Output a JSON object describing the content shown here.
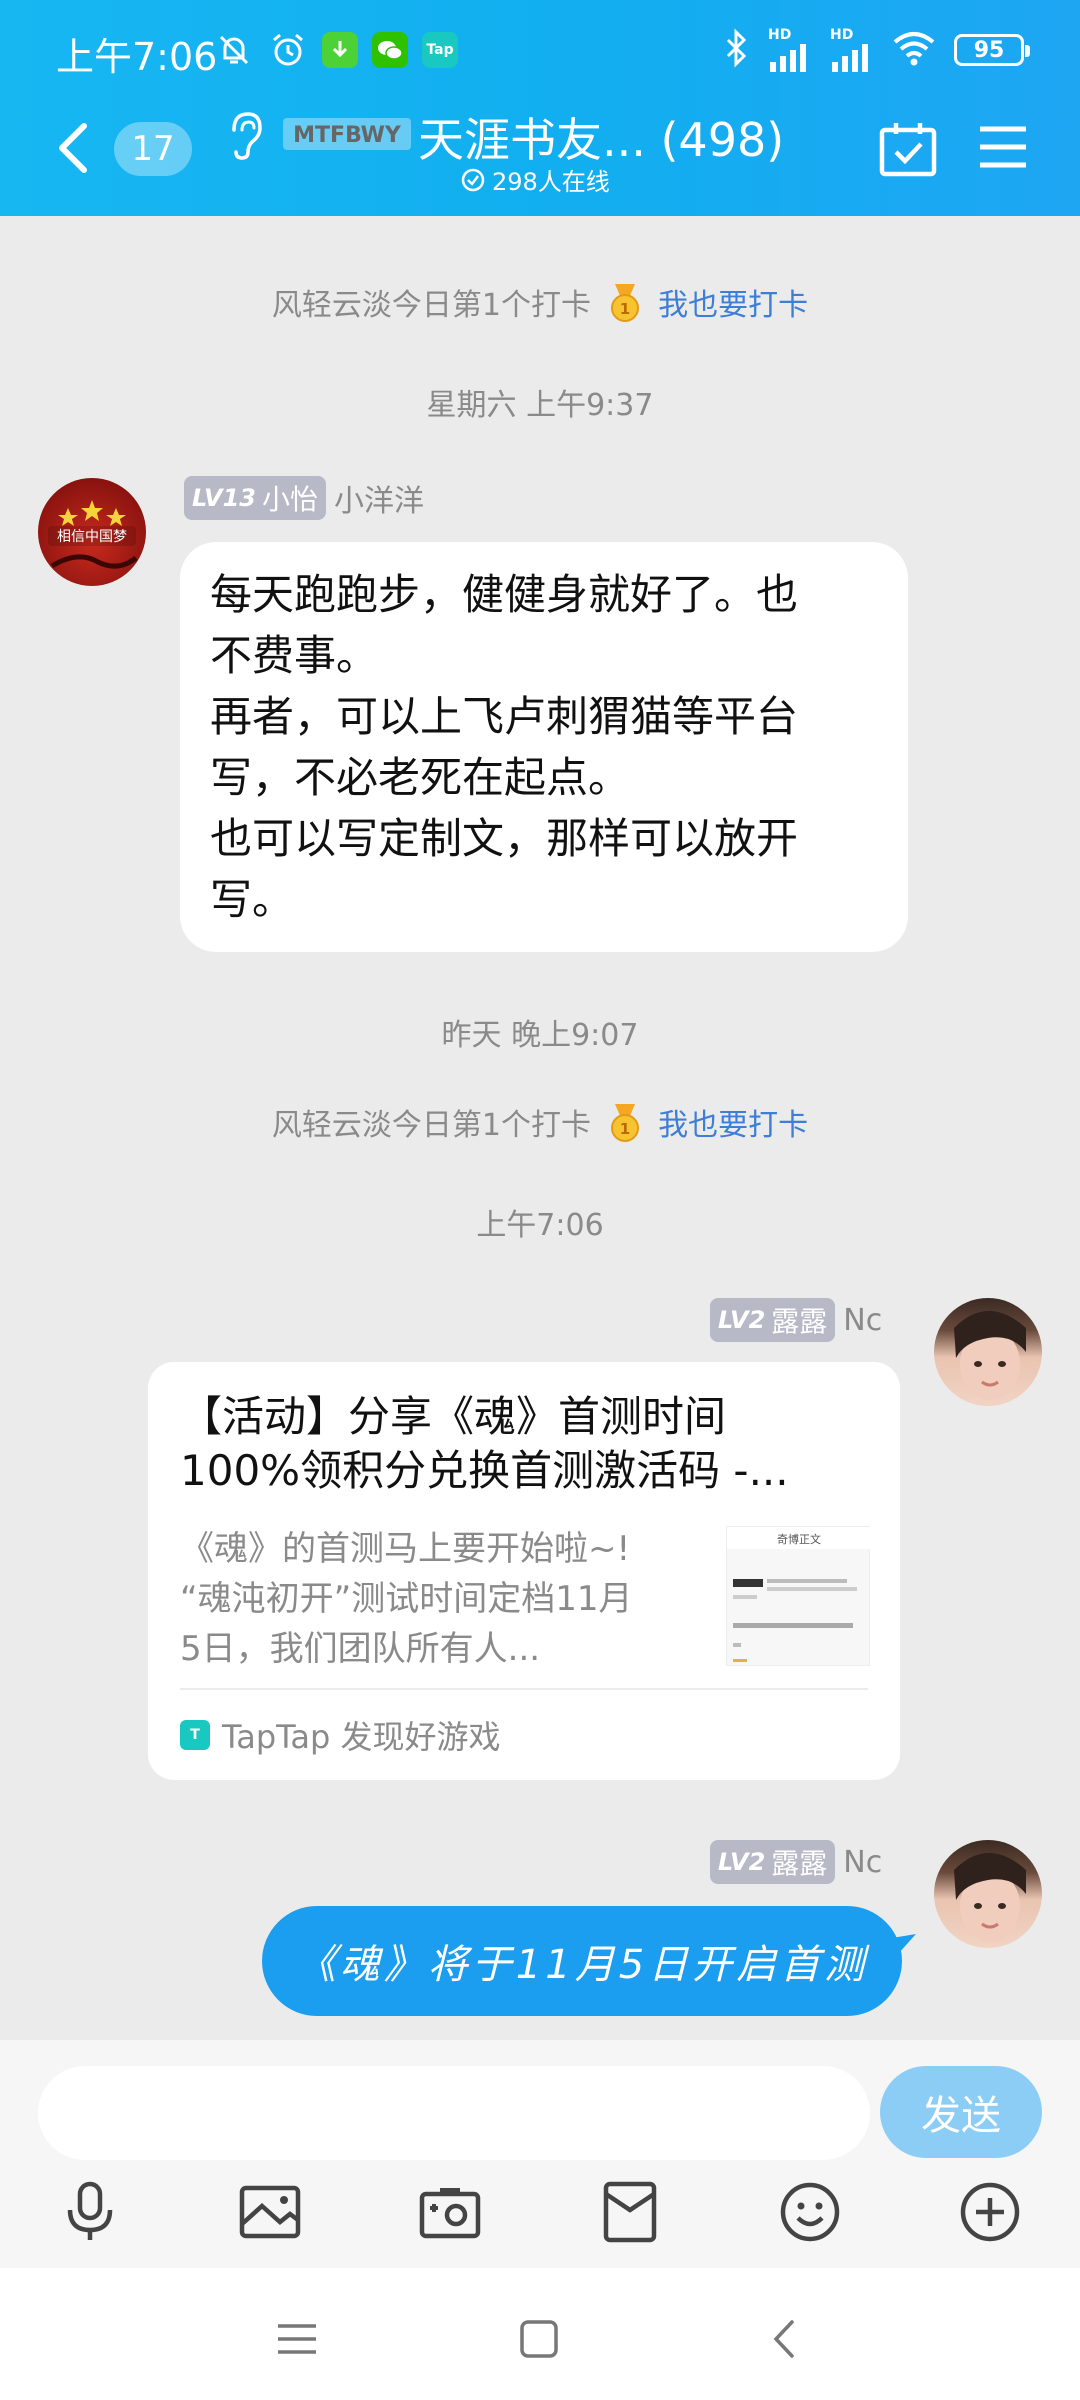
{
  "status_bar": {
    "time": "上午7:06",
    "battery": "95",
    "left_icons": [
      "mute-bell-icon",
      "alarm-icon",
      "download-app-icon",
      "wechat-icon",
      "taptap-app-icon"
    ],
    "right_icons": [
      "bluetooth-icon",
      "signal-hd-1-icon",
      "signal-hd-2-icon",
      "wifi-icon",
      "battery-icon"
    ],
    "hd_label": "HD"
  },
  "header": {
    "unread_count": "17",
    "brand_logo_text": "MTFBWY",
    "title": "天涯书友... (498)",
    "online": "298人在线",
    "background": "#12aef0"
  },
  "messages": [
    {
      "type": "system",
      "text": "风轻云淡今日第1个打卡",
      "link": "我也要打卡"
    },
    {
      "type": "time",
      "text": "星期六 上午9:37"
    },
    {
      "type": "incoming",
      "level": "LV13",
      "title": "小怡",
      "sender": "小洋洋",
      "avatar_text": "相信中国梦",
      "lines": [
        "每天跑跑步，健健身就好了。也",
        "不费事。",
        "再者，可以上飞卢刺猬猫等平台",
        "写，不必老死在起点。",
        "也可以写定制文，那样可以放开",
        "写。"
      ]
    },
    {
      "type": "time",
      "text": "昨天 晚上9:07"
    },
    {
      "type": "system",
      "text": "风轻云淡今日第1个打卡",
      "link": "我也要打卡"
    },
    {
      "type": "time",
      "text": "上午7:06"
    },
    {
      "type": "outgoing-card",
      "level": "LV2",
      "title": "露露",
      "sender": "Nc",
      "card_title_1": "【活动】分享《魂》首测时间",
      "card_title_2": "100%领积分兑换首测激活码 -...",
      "card_desc_1": "《魂》的首测马上要开始啦~!",
      "card_desc_2": "“魂沌初开”测试时间定档11月",
      "card_desc_3": "5日，我们团队所有人...",
      "thumb_heading": "奇博正文",
      "source": "TapTap 发现好游戏"
    },
    {
      "type": "outgoing",
      "level": "LV2",
      "title": "露露",
      "sender": "Nc",
      "text": "《魂》将于11月5日开启首测"
    }
  ],
  "input": {
    "placeholder": "",
    "send_label": "发送",
    "tools": [
      "microphone-icon",
      "image-icon",
      "camera-icon",
      "red-packet-icon",
      "emoji-icon",
      "plus-icon"
    ]
  },
  "system_nav": [
    "menu-nav-icon",
    "home-nav-icon",
    "back-nav-icon"
  ],
  "colors": {
    "accent": "#1c9ef0",
    "link": "#3d7fd6",
    "chat_bg": "#ebebeb",
    "level_badge": "#b7b9c7"
  }
}
